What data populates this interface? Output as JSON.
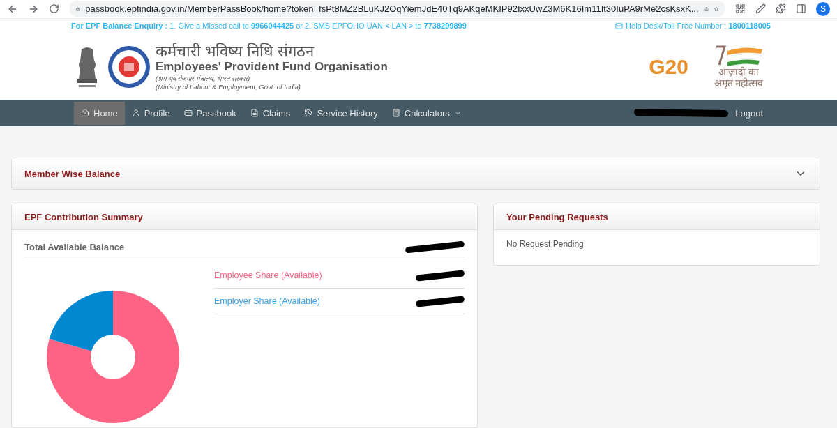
{
  "browser": {
    "url": "passbook.epfindia.gov.in/MemberPassBook/home?token=fsPt8MZ2BLuKJ2OqYiemJdE40Tq9AKqeMKIP92IxxUwZ3M6K16Im11It30IuPA9rMe2csKsxK...",
    "profile_initial": "S"
  },
  "info_bar": {
    "left": "**For EPF Balance Enquiry :** 1. Give a Missed call to **9966044425** or 2. SMS EPFOHO UAN < LAN > to **7738299899**",
    "right": "Help Desk/Toll Free Number : **1800118005**"
  },
  "header": {
    "title_hindi": "कर्मचारी भविष्य निधि संगठन",
    "title": "Employees' Provident Fund Organisation",
    "subtitle_hindi": "(श्रम एवं रोजगार मंत्रालय, भारत सरकार)",
    "subtitle": "(Ministry of Labour & Employment, Govt. of India)",
    "g20": "G20",
    "azadi_line1": "आज़ादी का",
    "azadi_line2": "अमृत महोत्सव"
  },
  "nav": {
    "items": [
      {
        "label": "Home",
        "kind": "home",
        "selected": true
      },
      {
        "label": "Profile",
        "kind": "profile",
        "selected": false
      },
      {
        "label": "Passbook",
        "kind": "passbook",
        "selected": false
      },
      {
        "label": "Claims",
        "kind": "claims",
        "selected": false
      },
      {
        "label": "Service History",
        "kind": "history",
        "selected": false
      },
      {
        "label": "Calculators",
        "kind": "calculators",
        "selected": false,
        "dropdown": true
      }
    ],
    "logout": "Logout"
  },
  "member_wise_balance": {
    "title": "Member Wise Balance",
    "expanded": false
  },
  "contribution_summary": {
    "title": "EPF Contribution Summary",
    "total_label": "Total Available Balance",
    "shares": [
      {
        "label": "Employee Share (Available)",
        "color": "#ff6384"
      },
      {
        "label": "Employer Share (Available)",
        "color": "#36a2eb"
      }
    ]
  },
  "pending_requests": {
    "title": "Your Pending Requests",
    "message": "No Request Pending"
  }
}
